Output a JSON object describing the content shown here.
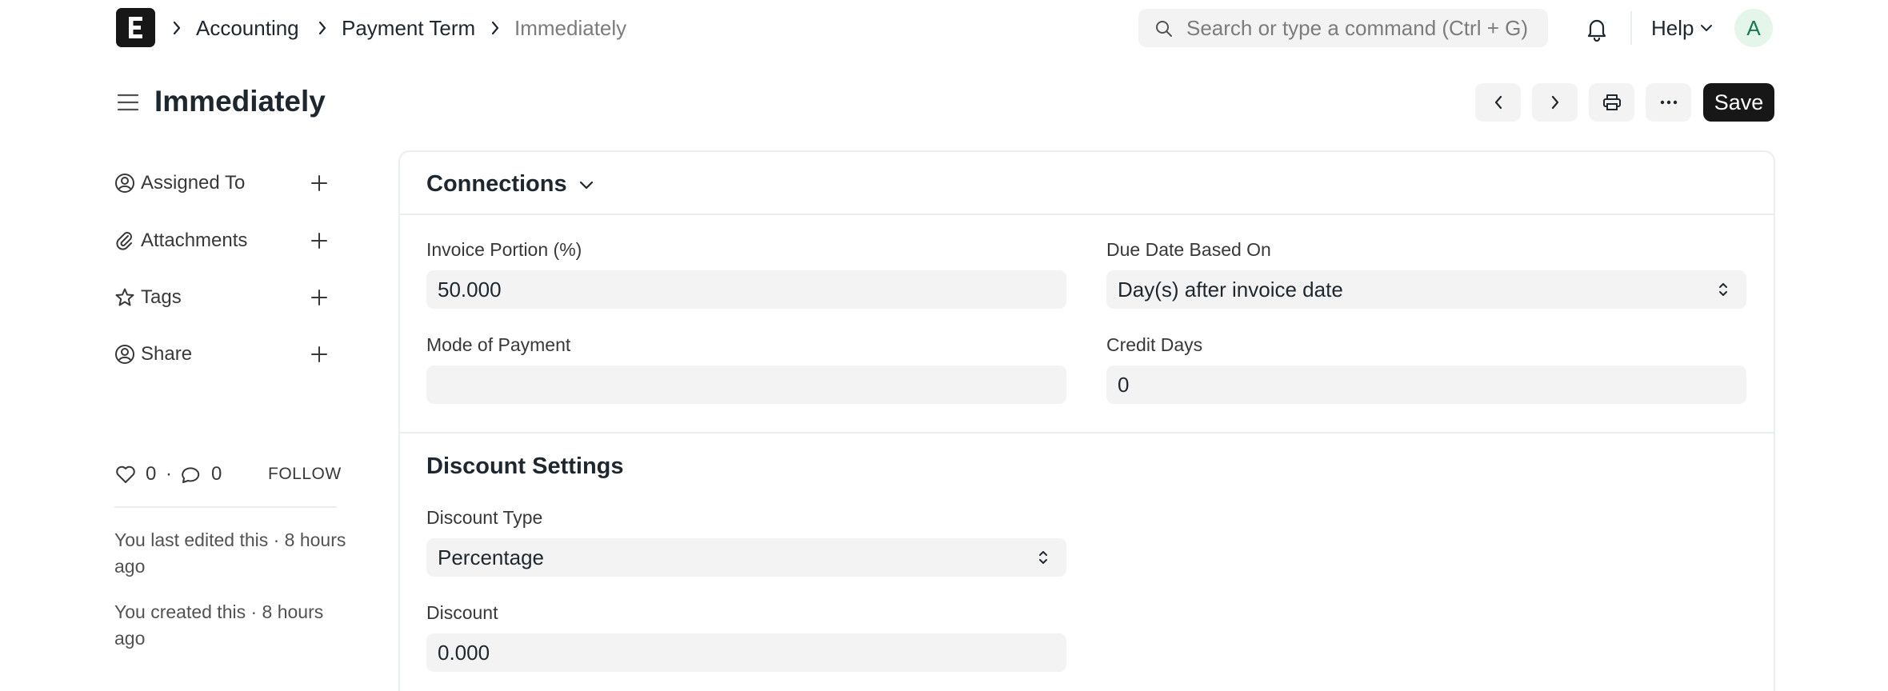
{
  "navbar": {
    "breadcrumbs": [
      "Accounting",
      "Payment Term",
      "Immediately"
    ],
    "search_placeholder": "Search or type a command (Ctrl + G)",
    "help_label": "Help",
    "avatar_initial": "A"
  },
  "page": {
    "title": "Immediately",
    "save_label": "Save"
  },
  "sidebar": {
    "items": [
      {
        "label": "Assigned To",
        "icon": "user-circle-icon"
      },
      {
        "label": "Attachments",
        "icon": "paperclip-icon"
      },
      {
        "label": "Tags",
        "icon": "star-icon"
      },
      {
        "label": "Share",
        "icon": "share-user-icon"
      }
    ],
    "likes": "0",
    "comments": "0",
    "separator": "·",
    "follow_label": "FOLLOW",
    "timeline": [
      "You last edited this · 8 hours ago",
      "You created this · 8 hours ago"
    ]
  },
  "connections": {
    "title": "Connections"
  },
  "form": {
    "invoice_portion": {
      "label": "Invoice Portion (%)",
      "value": "50.000"
    },
    "due_date_based_on": {
      "label": "Due Date Based On",
      "value": "Day(s) after invoice date"
    },
    "mode_of_payment": {
      "label": "Mode of Payment",
      "value": ""
    },
    "credit_days": {
      "label": "Credit Days",
      "value": "0"
    }
  },
  "discount_settings": {
    "title": "Discount Settings",
    "discount_type": {
      "label": "Discount Type",
      "value": "Percentage"
    },
    "discount": {
      "label": "Discount",
      "value": "0.000"
    }
  },
  "colors": {
    "primary_button": "#171717",
    "field_background": "#f3f3f3",
    "border": "#ebeef0",
    "avatar_bg": "#e4f5e9",
    "avatar_fg": "#16794c"
  }
}
